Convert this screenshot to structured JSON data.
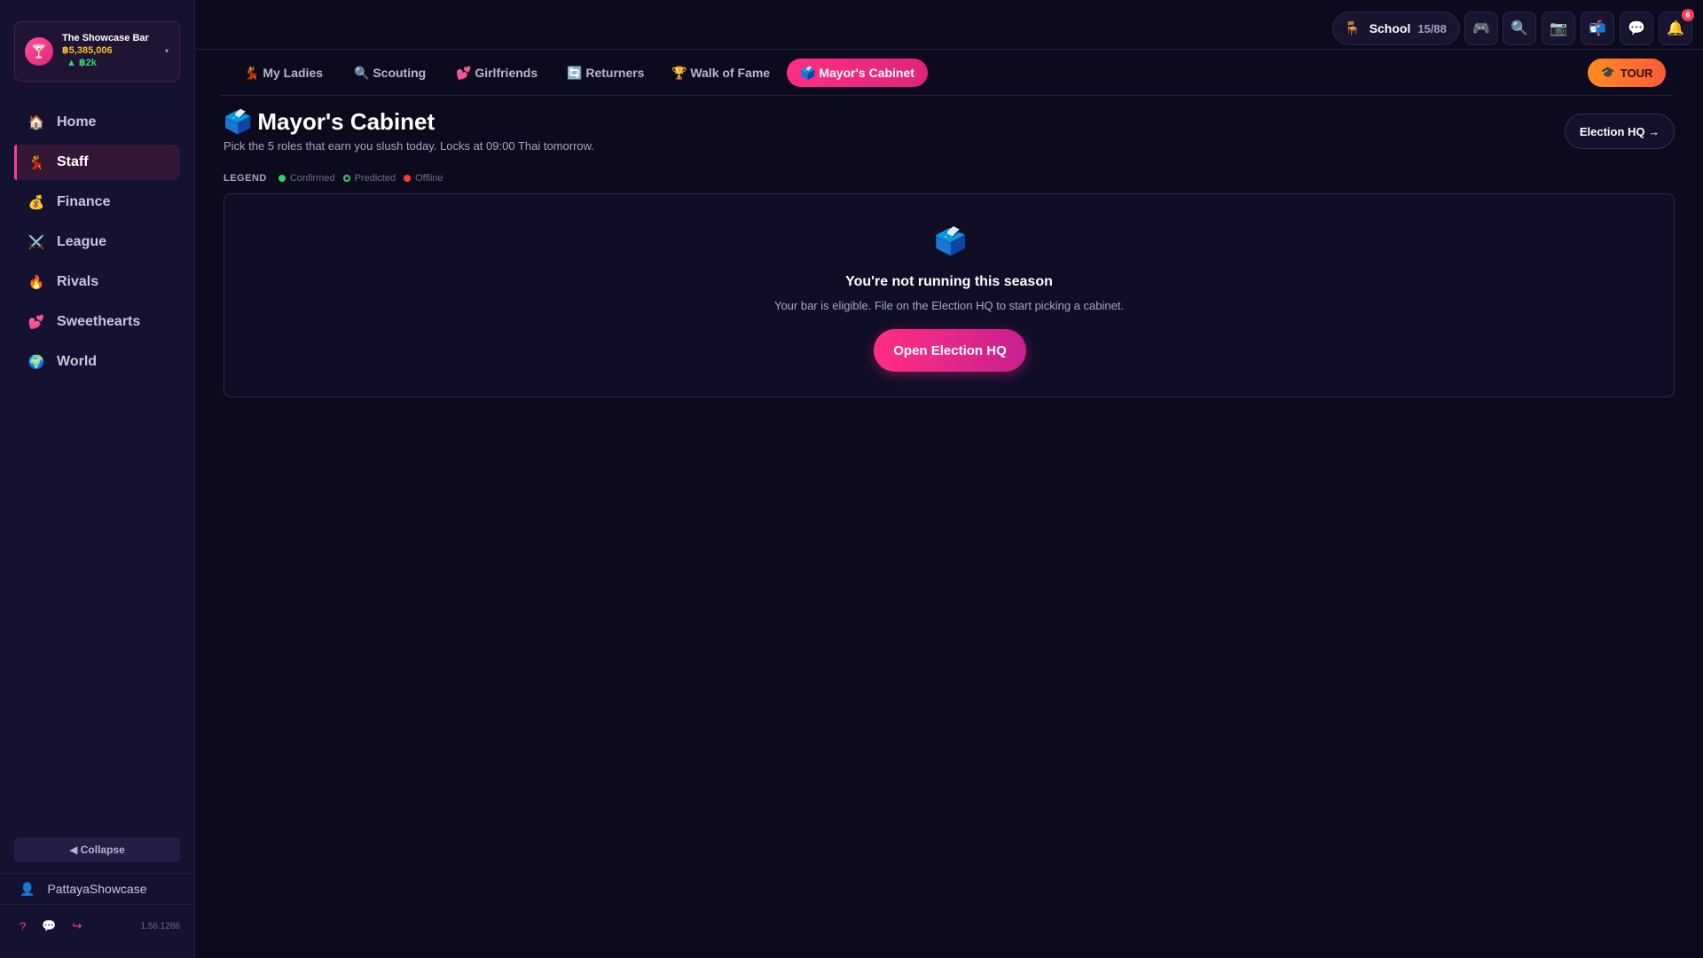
{
  "sidebar": {
    "bar_card": {
      "name": "The Showcase Bar",
      "money": "฿5,385,006",
      "delta": "▲ ฿2k",
      "avatar_icon": "🍸",
      "chevron": "▾"
    },
    "items": [
      {
        "icon": "🏠",
        "label": "Home"
      },
      {
        "icon": "💃",
        "label": "Staff",
        "active": true
      },
      {
        "icon": "💰",
        "label": "Finance"
      },
      {
        "icon": "⚔️",
        "label": "League"
      },
      {
        "icon": "🔥",
        "label": "Rivals"
      },
      {
        "icon": "💕",
        "label": "Sweethearts"
      },
      {
        "icon": "🌍",
        "label": "World"
      }
    ],
    "collapse_label": "◀ Collapse",
    "user_icon": "👤",
    "username": "PattayaShowcase",
    "footer_icons": [
      "?",
      "💬",
      "↪"
    ],
    "version": "1.56.1286"
  },
  "topbar": {
    "school": {
      "icon": "🪑",
      "label": "School",
      "count": "15/88"
    },
    "buttons": [
      {
        "name": "gamepad-icon",
        "icon": "🎮"
      },
      {
        "name": "search-icon",
        "icon": "🔍"
      },
      {
        "name": "camera-icon",
        "icon": "📷"
      },
      {
        "name": "mailbox-icon",
        "icon": "📬"
      },
      {
        "name": "chat-icon",
        "icon": "💬"
      },
      {
        "name": "bell-icon",
        "icon": "🔔"
      }
    ],
    "notifications": "6"
  },
  "tabs": [
    {
      "icon": "💃",
      "label": "My Ladies"
    },
    {
      "icon": "🔍",
      "label": "Scouting"
    },
    {
      "icon": "💕",
      "label": "Girlfriends"
    },
    {
      "icon": "🔄",
      "label": "Returners"
    },
    {
      "icon": "🏆",
      "label": "Walk of Fame"
    },
    {
      "icon": "🗳️",
      "label": "Mayor's Cabinet",
      "active": true
    }
  ],
  "tour": {
    "icon": "🎓",
    "label": "TOUR"
  },
  "page": {
    "icon": "🗳️",
    "title": "Mayor's Cabinet",
    "subtitle": "Pick the 5 roles that earn you slush today. Locks at 09:00 Thai tomorrow.",
    "hq_button": "Election HQ →"
  },
  "legend": {
    "title": "LEGEND",
    "items": [
      {
        "label": "Confirmed",
        "color": "#2bd46d",
        "style": "filled"
      },
      {
        "label": "Predicted",
        "color": "#2bd46d",
        "style": "ring"
      },
      {
        "label": "Offline",
        "color": "#ff3b3b",
        "style": "filled"
      }
    ]
  },
  "empty_state": {
    "icon": "🗳️",
    "title": "You're not running this season",
    "text": "Your bar is eligible. File on the Election HQ to start picking a cabinet.",
    "button": "Open Election HQ"
  },
  "colors": {
    "accent": "#ff2e83",
    "background": "#0c0b1d",
    "sidebar": "#141230"
  }
}
